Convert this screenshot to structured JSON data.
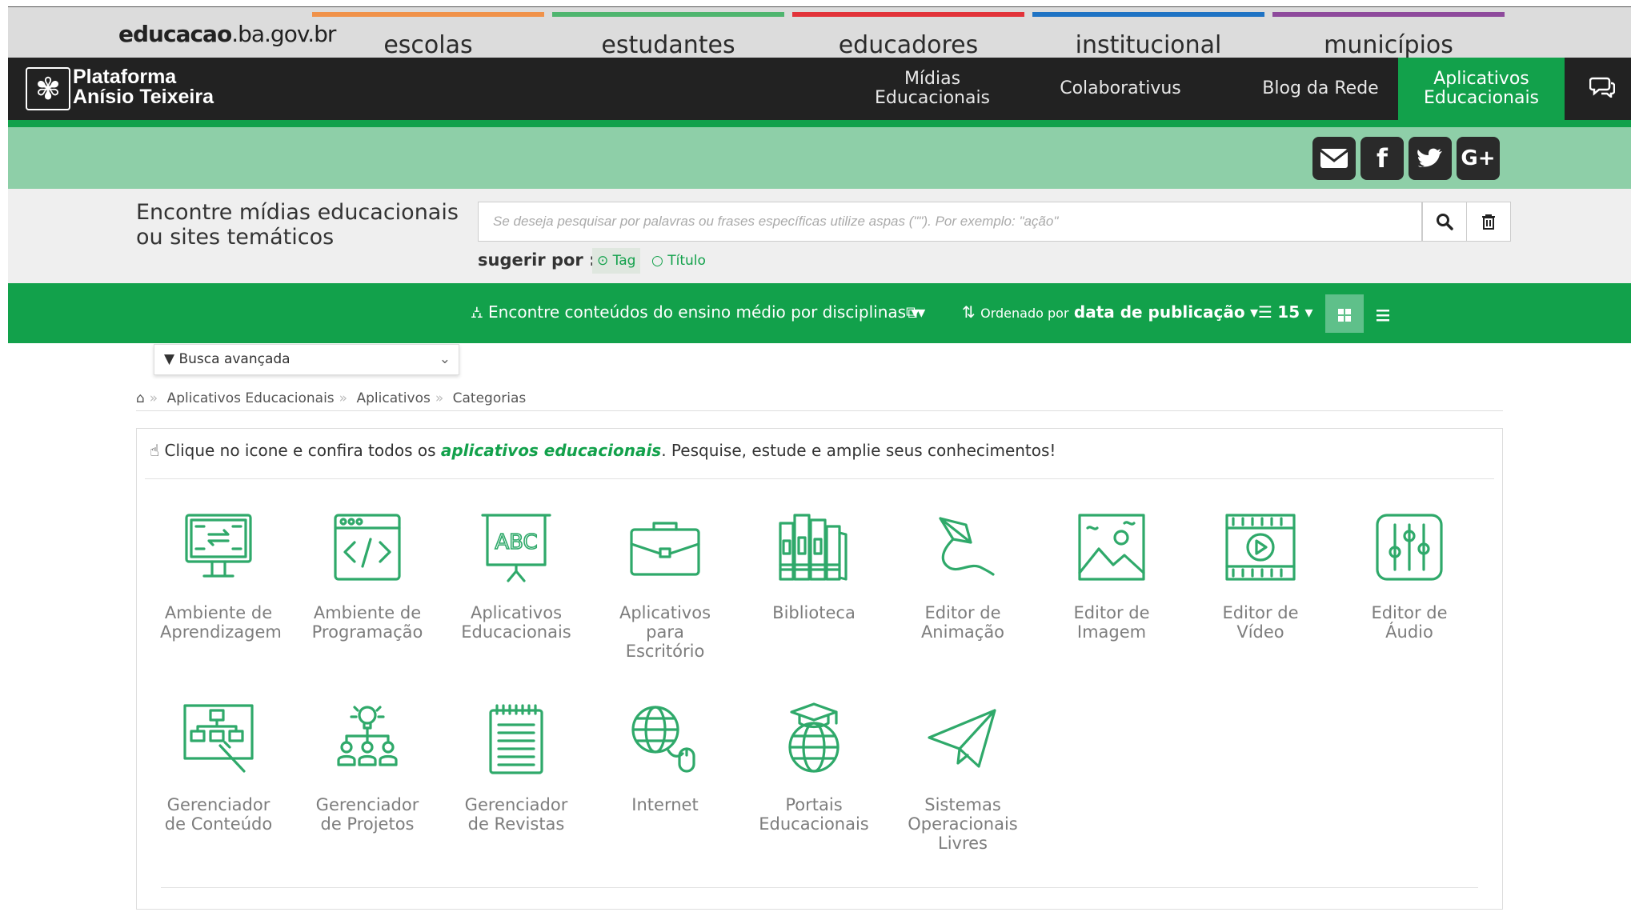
{
  "portal": {
    "domain_bold": "educacao",
    "domain_rest": ".ba.gov.br",
    "tabs": [
      {
        "label": "escolas",
        "color": "#f0924a"
      },
      {
        "label": "estudantes",
        "color": "#4fb56f"
      },
      {
        "label": "educadores",
        "color": "#e2333a"
      },
      {
        "label": "institucional",
        "color": "#1f73c4"
      },
      {
        "label": "municípios",
        "color": "#8e4a9c"
      }
    ]
  },
  "nav": {
    "logo_line1": "Plataforma",
    "logo_line2": "Anísio Teixeira",
    "links": [
      {
        "label": "Mídias Educacionais"
      },
      {
        "label": "Colaborativus"
      },
      {
        "label": "Blog da Rede"
      },
      {
        "label": "Aplicativos Educacionais",
        "active": true
      }
    ]
  },
  "social": [
    "envelope-icon",
    "facebook-icon",
    "twitter-icon",
    "google-plus-icon"
  ],
  "search": {
    "label": "Encontre mídias educacionais ou sites temáticos",
    "placeholder": "Se deseja pesquisar por palavras ou frases específicas utilize aspas (\"\"). Por exemplo: \"ação\"",
    "suggest_label": "sugerir por :",
    "options": [
      "Tag",
      "Título"
    ],
    "selected_option": "Tag"
  },
  "filter": {
    "disciplines": "Encontre conteúdos do ensino médio por disciplinas",
    "sort_prefix": "Ordenado por",
    "sort_value": "data de publicação",
    "per_page": "15"
  },
  "advanced": {
    "label": "Busca avançada"
  },
  "breadcrumb": [
    "Aplicativos Educacionais",
    "Aplicativos",
    "Categorias"
  ],
  "intro": {
    "before": "Clique no icone e confira todos os ",
    "highlight": "aplicativos educacionais",
    "after": ". Pesquise, estude e amplie seus conhecimentos!"
  },
  "categories": [
    {
      "label": "Ambiente de Aprendizagem",
      "icon": "monitor-exchange-icon"
    },
    {
      "label": "Ambiente de Programação",
      "icon": "code-window-icon"
    },
    {
      "label": "Aplicativos Educacionais",
      "icon": "presentation-board-icon"
    },
    {
      "label": "Aplicativos para Escritório",
      "icon": "briefcase-icon"
    },
    {
      "label": "Biblioteca",
      "icon": "books-icon"
    },
    {
      "label": "Editor de Animação",
      "icon": "kite-icon"
    },
    {
      "label": "Editor de Imagem",
      "icon": "image-icon"
    },
    {
      "label": "Editor de Vídeo",
      "icon": "film-play-icon"
    },
    {
      "label": "Editor de Áudio",
      "icon": "sliders-icon"
    },
    {
      "label": "Gerenciador de Conteúdo",
      "icon": "sitemap-hand-icon"
    },
    {
      "label": "Gerenciador de Projetos",
      "icon": "team-idea-icon"
    },
    {
      "label": "Gerenciador de Revistas",
      "icon": "notepad-icon"
    },
    {
      "label": "Internet",
      "icon": "globe-mouse-icon"
    },
    {
      "label": "Portais Educacionais",
      "icon": "globe-graduation-icon"
    },
    {
      "label": "Sistemas Operacionais Livres",
      "icon": "paper-plane-icon"
    }
  ],
  "colors": {
    "brand_green": "#12a14b",
    "icon_green": "#2fa96a",
    "nav_dark": "#222222",
    "social_band": "#8ecfa8"
  }
}
